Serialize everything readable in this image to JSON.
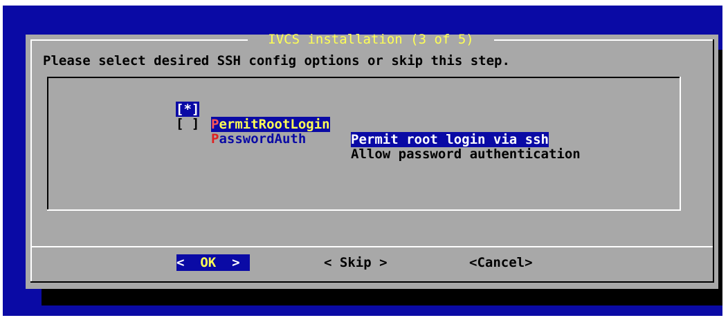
{
  "dialog": {
    "title": "IVCS installation (3 of 5)",
    "prompt": "Please select desired SSH config options or skip this step."
  },
  "options": [
    {
      "checkbox": "[*]",
      "tag_first": "P",
      "tag_rest": "ermitRootLogin",
      "description": "Permit root login via ssh",
      "checked": true,
      "selected": true
    },
    {
      "checkbox": "[ ]",
      "tag_first": "P",
      "tag_rest": "asswordAuth",
      "description": "Allow password authentication",
      "checked": false,
      "selected": false
    }
  ],
  "buttons": {
    "ok": {
      "left": "<",
      "label": "OK",
      "right": ">"
    },
    "skip": "< Skip >",
    "cancel": "<Cancel>"
  },
  "colors": {
    "screen_background": "#0a0aa5",
    "dialog_background": "#a8a8a8",
    "title_text": "#ffff55",
    "hotkey": "#e02020",
    "selection": "#0a0aa5"
  }
}
